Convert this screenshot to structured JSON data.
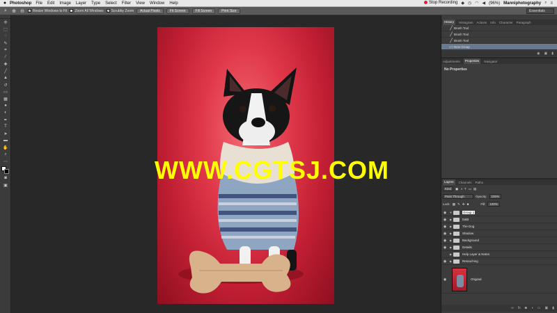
{
  "menubar": {
    "apple": "",
    "app": "Photoshop",
    "items": [
      "File",
      "Edit",
      "Image",
      "Layer",
      "Type",
      "Select",
      "Filter",
      "View",
      "Window",
      "Help"
    ],
    "recording": "Stop Recording",
    "battery": "(96%)",
    "user": "Manniphotography"
  },
  "options": {
    "resize_windows": "Resize Windows to Fit",
    "zoom_all": "Zoom All Windows",
    "scrubby": "Scrubby Zoom",
    "actual_pixels": "Actual Pixels",
    "fit_screen": "Fit Screen",
    "fill_screen": "Fill Screen",
    "print_size": "Print Size",
    "workspace": "Essentials"
  },
  "watermark": "WWW.CGTSJ.COM",
  "history": {
    "tabs": [
      "History",
      "Histogram",
      "Actions",
      "Info",
      "Character",
      "Paragraph"
    ],
    "rows": [
      "Brush Tool",
      "Brush Tool",
      "Brush Tool",
      "New Group"
    ]
  },
  "properties": {
    "tabs": [
      "Adjustments",
      "Properties",
      "Navigator"
    ],
    "message": "No Properties"
  },
  "layers": {
    "tabs": [
      "Layers",
      "Channels",
      "Paths"
    ],
    "kind": "Kind",
    "blend": "Pass Through",
    "opacity_label": "Opacity:",
    "opacity": "100%",
    "lock_label": "Lock:",
    "fill_label": "Fill:",
    "fill": "100%",
    "rows": [
      "Group 1",
      "D&B",
      "The Dog",
      "Shadow",
      "Background",
      "Details",
      "Help Layer & Notes",
      "Retouching"
    ],
    "original": "Original"
  },
  "colors": {
    "backdrop": "#c01e33",
    "watermark": "#ffff00",
    "selected_row": "#6a7a8e"
  }
}
